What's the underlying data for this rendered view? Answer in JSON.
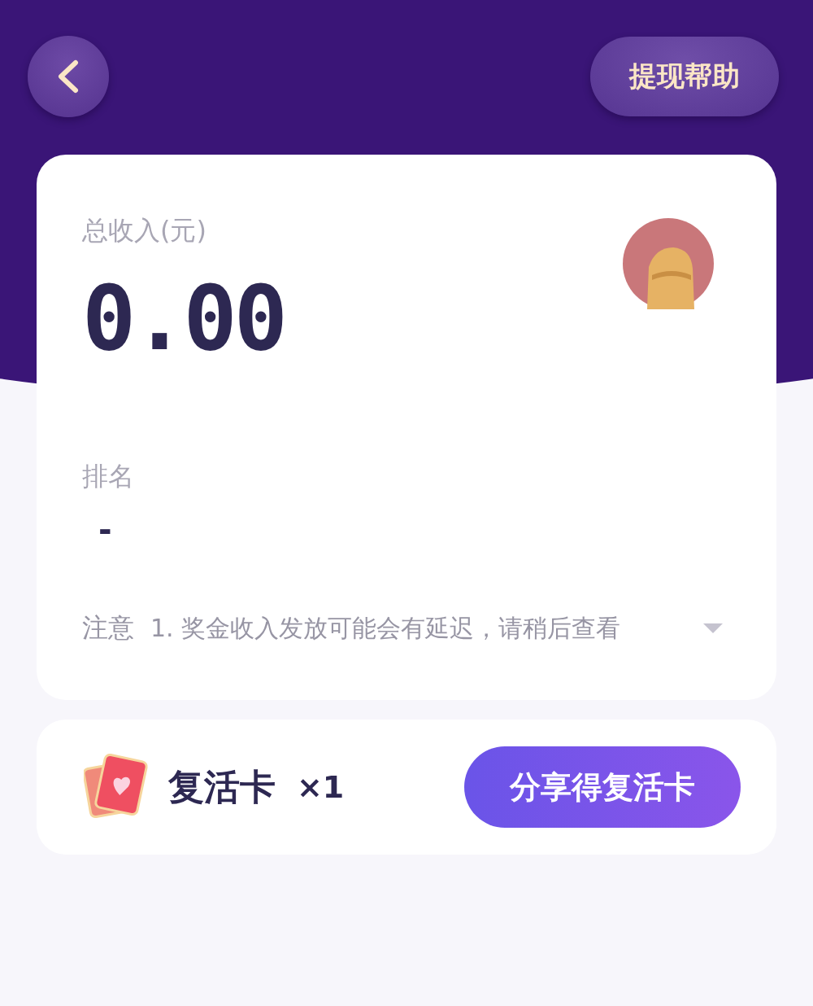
{
  "header": {
    "back_button": {
      "kind": "back"
    },
    "help_button": {
      "label": "提现帮助"
    }
  },
  "income_card": {
    "total_label": "总收入(元)",
    "total_value": "0.00",
    "avatar": {
      "kind": "avatar"
    },
    "rank_label": "排名",
    "rank_value": "-",
    "notice": {
      "label": "注意",
      "text": "1. 奖金收入发放可能会有延迟，请稍后查看",
      "expanded": false
    }
  },
  "revive_card": {
    "title": "复活卡",
    "count": "×1",
    "share_button": {
      "label": "分享得复活卡"
    }
  }
}
